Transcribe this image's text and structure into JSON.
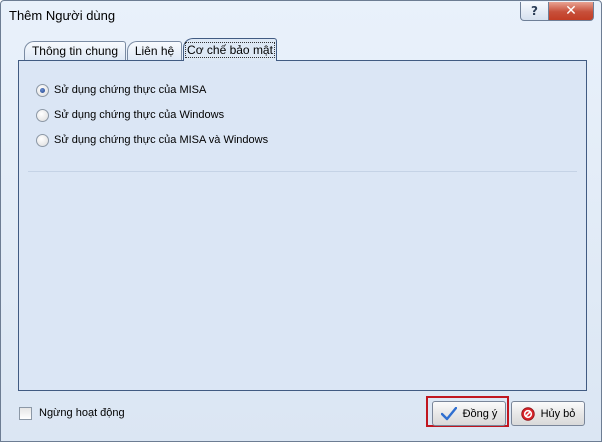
{
  "window": {
    "title": "Thêm Người dùng",
    "help_glyph": "?",
    "close_glyph": "✕"
  },
  "tabs": [
    {
      "label": "Thông tin chung",
      "active": false
    },
    {
      "label": "Liên hệ",
      "active": false
    },
    {
      "label": "Cơ chế bảo mật",
      "active": true
    }
  ],
  "auth_options": [
    {
      "label": "Sử dụng chứng thực của MISA",
      "selected": true
    },
    {
      "label": "Sử dụng chứng thực của Windows",
      "selected": false
    },
    {
      "label": "Sử dụng chứng thực của MISA và Windows",
      "selected": false
    }
  ],
  "footer": {
    "inactive_label": "Ngừng hoạt động",
    "inactive_checked": false,
    "ok_label": "Đồng ý",
    "cancel_label": "Hủy bỏ"
  },
  "icons": {
    "ok": "checkmark-icon",
    "cancel": "no-entry-icon"
  },
  "colors": {
    "highlight": "#c0161f",
    "panel": "#dbe6f5",
    "close_button": "#c74f3a"
  }
}
